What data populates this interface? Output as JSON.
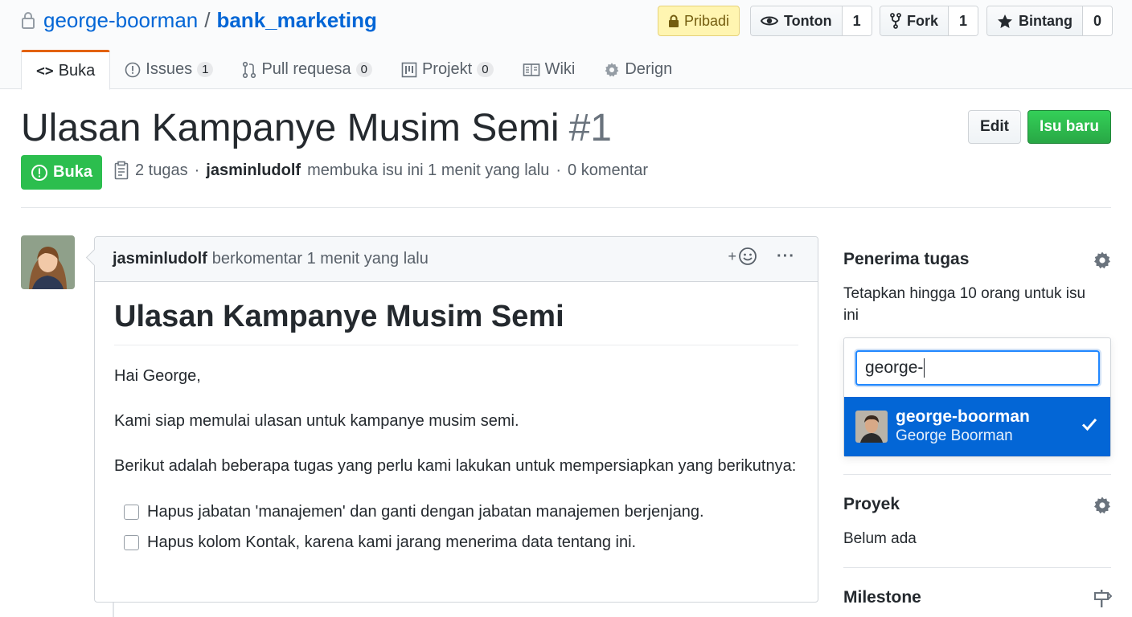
{
  "repo": {
    "owner": "george-boorman",
    "separator": "/",
    "name": "bank_marketing"
  },
  "header": {
    "private_label": "Pribadi",
    "watch": {
      "label": "Tonton",
      "count": "1"
    },
    "fork": {
      "label": "Fork",
      "count": "1"
    },
    "star": {
      "label": "Bintang",
      "count": "0"
    }
  },
  "tabs": [
    {
      "label": "Buka",
      "icon": "code-icon"
    },
    {
      "label": "Issues",
      "count": "1",
      "icon": "issue-icon"
    },
    {
      "label": "Pull requesa",
      "count": "0",
      "icon": "pull-request-icon"
    },
    {
      "label": "Projekt",
      "count": "0",
      "icon": "project-icon"
    },
    {
      "label": "Wiki",
      "icon": "book-icon"
    },
    {
      "label": "Derign",
      "icon": "gear-icon"
    }
  ],
  "issue": {
    "title": "Ulasan Kampanye Musim Semi",
    "number": "#1",
    "state": "Buka",
    "tasks": "2 tugas",
    "author": "jasminludolf",
    "opened_text": "membuka isu ini 1 menit yang lalu",
    "comments": "0 komentar",
    "dot": "·",
    "edit_label": "Edit",
    "new_label": "Isu baru"
  },
  "comment": {
    "author": "jasminludolf",
    "time": "berkomentar 1 menit yang lalu",
    "reaction": "+",
    "more": "···",
    "heading": "Ulasan Kampanye Musim Semi",
    "greeting": "Hai George,",
    "para1": "Kami siap memulai ulasan untuk kampanye musim semi.",
    "para2": "Berikut adalah beberapa tugas yang perlu kami lakukan untuk mempersiapkan yang berikutnya:",
    "tasks": [
      "Hapus jabatan 'manajemen' dan ganti dengan jabatan manajemen berjenjang.",
      "Hapus kolom Kontak, karena kami jarang menerima data tentang ini."
    ]
  },
  "sidebar": {
    "assignees": {
      "title": "Penerima tugas",
      "hint": "Tetapkan hingga 10 orang untuk isu ini",
      "search_value": "george-",
      "result": {
        "login": "george-boorman",
        "name": "George Boorman"
      }
    },
    "projects": {
      "title": "Proyek",
      "empty": "Belum ada"
    },
    "milestone": {
      "title": "Milestone"
    }
  },
  "colors": {
    "link": "#0366d6",
    "green": "#2cbe4e",
    "selected": "#0366d6",
    "tab_accent": "#e36209"
  }
}
